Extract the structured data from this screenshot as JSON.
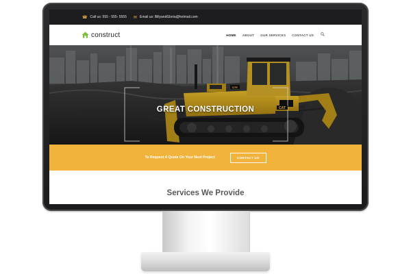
{
  "topbar": {
    "phone_text": "Call us: 555 - 555- 5555",
    "email_text": "Email us: BillyandGloria@hotmail.com",
    "phone_icon": "phone-icon",
    "email_icon": "envelope-icon"
  },
  "navbar": {
    "logo_text": "construct",
    "logo_icon": "house-icon",
    "items": [
      {
        "label": "HOME",
        "active": true
      },
      {
        "label": "ABOUT"
      },
      {
        "label": "OUR SERVICES"
      },
      {
        "label": "CONTACT US"
      }
    ],
    "search_icon": "search-icon"
  },
  "hero": {
    "title": "GREAT CONSTRUCTION",
    "machine_brand": "CAT",
    "machine_model": "D7E"
  },
  "quote_bar": {
    "text": "To Request A Quote On Your Next Project",
    "button_label": "CONTACT US"
  },
  "services": {
    "title": "Services We Provide"
  },
  "colors": {
    "accent": "#f2b33d",
    "logo_green": "#7cbf3a",
    "topbar_bg": "#1d1d1f",
    "monitor_bezel": "#2b2b2d"
  }
}
